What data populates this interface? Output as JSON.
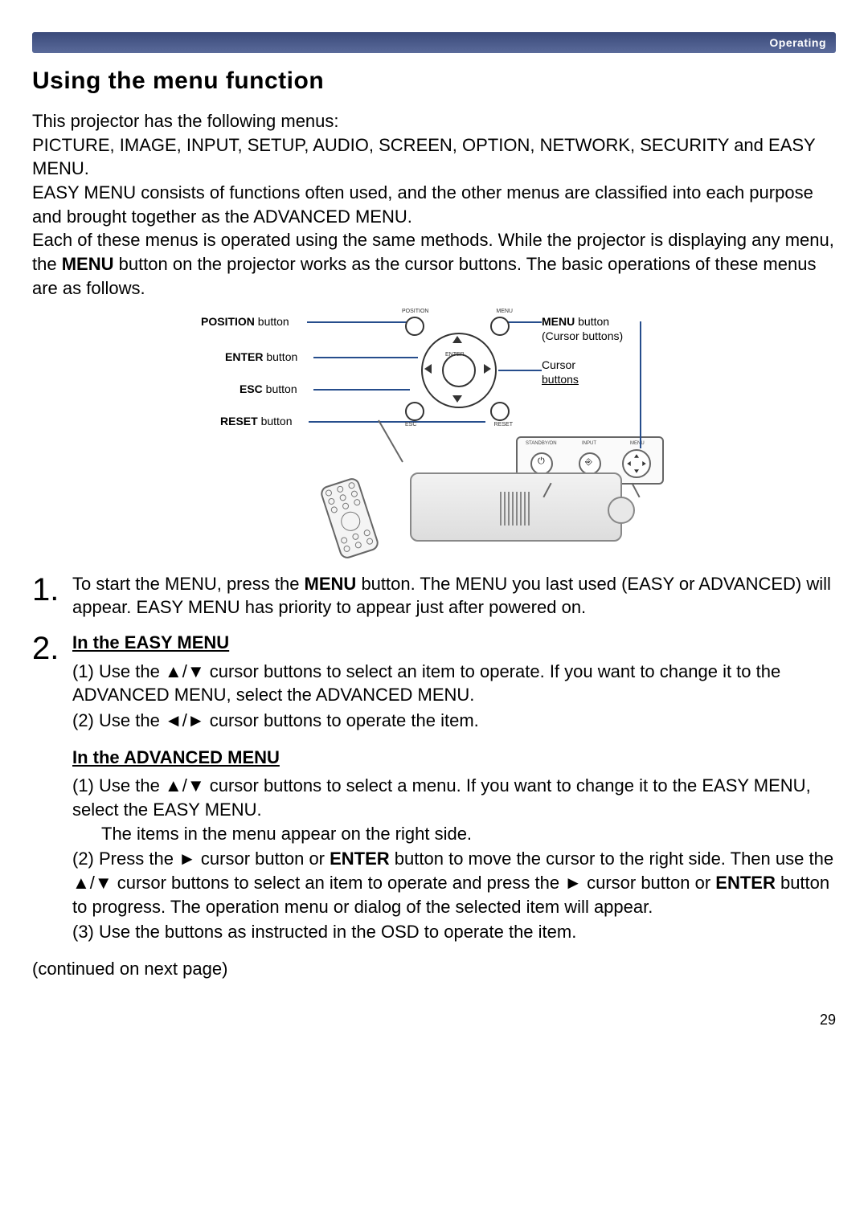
{
  "header": {
    "section": "Operating"
  },
  "title": "Using the menu function",
  "intro": {
    "p1": "This projector has the following menus:",
    "p2": "PICTURE, IMAGE, INPUT, SETUP, AUDIO, SCREEN, OPTION, NETWORK, SECURITY and EASY MENU.",
    "p3_a": "EASY MENU consists of functions often used, and the other menus are classified into each purpose and brought together as the ADVANCED MENU.",
    "p3_b": "Each of these menus is operated using the same methods. While the projector is displaying any menu, the ",
    "p3_menu": "MENU",
    "p3_c": " button on the projector works as the cursor buttons. The basic operations of these menus are as follows."
  },
  "diagram": {
    "position_btn": "POSITION",
    "enter_btn": "ENTER",
    "esc_btn": "ESC",
    "reset_btn": "RESET",
    "menu_btn": "MENU",
    "button_word": " button",
    "cursor_buttons_paren": "(Cursor buttons)",
    "cursor_word": "Cursor",
    "buttons_word": "buttons",
    "pad_position": "POSITION",
    "pad_menu": "MENU",
    "pad_enter": "ENTER",
    "pad_esc": "ESC",
    "pad_reset": "RESET",
    "panel_standby": "STANDBY/ON",
    "panel_input": "INPUT",
    "panel_menu": "MENU"
  },
  "steps": {
    "s1_num": "1.",
    "s1_a": "To start the MENU, press the ",
    "s1_menu": "MENU",
    "s1_b": " button. The MENU you last used (EASY or ADVANCED) will appear. EASY MENU has priority to appear just after powered on.",
    "s2_num": "2.",
    "s2_easy_head": "In the EASY MENU",
    "s2_easy_1": "(1) Use the ▲/▼ cursor buttons to select an item to operate. If you want to change it to the ADVANCED MENU, select the ADVANCED MENU.",
    "s2_easy_2": "(2) Use the ◄/► cursor buttons to operate the item.",
    "s2_adv_head": "In the ADVANCED MENU",
    "s2_adv_1": "(1) Use the ▲/▼ cursor buttons to select a menu. If you want to change it to the EASY MENU, select the EASY MENU.",
    "s2_adv_1b": "The items in the menu appear on the right side.",
    "s2_adv_2a": "(2) Press the ► cursor button or ",
    "s2_adv_enter1": "ENTER",
    "s2_adv_2b": " button to move the cursor to the right side. Then use the ▲/▼ cursor buttons to select an item to operate and press the ► cursor button or ",
    "s2_adv_enter2": "ENTER",
    "s2_adv_2c": " button to progress. The operation menu or dialog of the selected item will appear.",
    "s2_adv_3": "(3) Use the buttons as instructed in the OSD to operate the item."
  },
  "continued": "(continued on next page)",
  "page_number": "29"
}
